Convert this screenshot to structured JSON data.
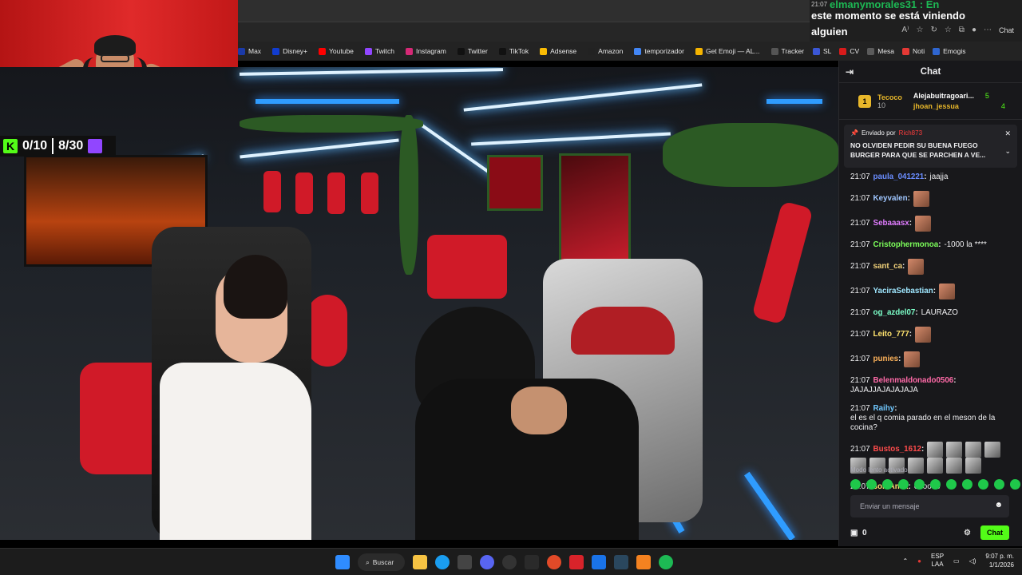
{
  "notification": {
    "time": "21:07",
    "sender": "elmanymorales31 : En",
    "text_line1": "este momento se está viniendo",
    "text_line2": "alguien",
    "chat_label": "Chat"
  },
  "bookmarks": [
    {
      "label": "Max",
      "color": "#1b3aa8"
    },
    {
      "label": "Disney+",
      "color": "#113ccf"
    },
    {
      "label": "Youtube",
      "color": "#ff0000"
    },
    {
      "label": "Twitch",
      "color": "#9146ff"
    },
    {
      "label": "Instagram",
      "color": "#d62976"
    },
    {
      "label": "Twitter",
      "color": "#111111"
    },
    {
      "label": "TikTok",
      "color": "#111111"
    },
    {
      "label": "Adsense",
      "color": "#fbbc04"
    },
    {
      "label": "Amazon",
      "color": "#222222"
    },
    {
      "label": "temporizador",
      "color": "#4285f4"
    },
    {
      "label": "Get Emoji — AL...",
      "color": "#f5b400"
    },
    {
      "label": "Tracker",
      "color": "#555555"
    }
  ],
  "bookmarks_right": [
    {
      "label": "SL",
      "color": "#3b57d6"
    },
    {
      "label": "CV",
      "color": "#d81b1b"
    },
    {
      "label": "Mesa",
      "color": "#5b5b5b"
    },
    {
      "label": "Noti",
      "color": "#e53935"
    },
    {
      "label": "Emogis",
      "color": "#2f66d0"
    }
  ],
  "scoreboard": {
    "left": "0/10",
    "right": "8/30"
  },
  "chat": {
    "title": "Chat",
    "leaders": [
      {
        "rank": "1",
        "name": "Tecoco",
        "points": "10"
      },
      {
        "name": "Alejabuitragoari...",
        "points": "5"
      },
      {
        "name": "jhoan_jessua",
        "points": "4"
      }
    ],
    "pinned": {
      "by_label": "Enviado por",
      "by_name": "Rich873",
      "message": "NO OLVIDEN PEDIR SU BUENA FUEGO BURGER PARA QUE SE PARCHEN A VE..."
    },
    "messages": [
      {
        "time": "21:07",
        "user": "paula_041221",
        "color": "#6a8dff",
        "text": "jaajja",
        "emotes": 0
      },
      {
        "time": "21:07",
        "user": "Keyvalen",
        "color": "#9fc6ff",
        "text": "",
        "emotes": 1
      },
      {
        "time": "21:07",
        "user": "Sebaaasx",
        "color": "#e07cff",
        "text": "",
        "emotes": 1
      },
      {
        "time": "21:07",
        "user": "Cristophermonoa",
        "color": "#7cff5a",
        "text": "-1000 la ****",
        "emotes": 0
      },
      {
        "time": "21:07",
        "user": "sant_ca",
        "color": "#f2d27a",
        "text": "",
        "emotes": 1
      },
      {
        "time": "21:07",
        "user": "YaciraSebastian",
        "color": "#9fe7ff",
        "text": "",
        "emotes": 1
      },
      {
        "time": "21:07",
        "user": "og_azdel07",
        "color": "#7cffc9",
        "text": "LAURAZO",
        "emotes": 0
      },
      {
        "time": "21:07",
        "user": "Leito_777",
        "color": "#ffe36e",
        "text": "",
        "emotes": 1
      },
      {
        "time": "21:07",
        "user": "punies",
        "color": "#ffb35a",
        "text": "",
        "emotes": 1
      },
      {
        "time": "21:07",
        "user": "Belenmaldonado0506",
        "color": "#ff6aa8",
        "text": "JAJAJJAJAJAJAJA",
        "emotes": 0
      },
      {
        "time": "21:07",
        "user": "Raihy",
        "color": "#70c8ff",
        "text": "el es el q comia parado en el meson de la cocina?",
        "emotes": 0
      },
      {
        "time": "21:07",
        "user": "Bustos_1612",
        "color": "#ff4b4b",
        "text": "",
        "emotes": 11
      },
      {
        "time": "21:07",
        "user": "soloAnax",
        "color": "#ffe36e",
        "text": "oooooo",
        "emotes": 0
      }
    ],
    "slow_mode": "Modo lento activado",
    "input_placeholder": "Enviar un mensaje",
    "balance": "0",
    "send_label": "Chat"
  },
  "taskbar": {
    "search_label": "Buscar",
    "lang_line1": "ESP",
    "lang_line2": "LAA",
    "time": "9:07 p. m.",
    "date": "1/1/2026"
  }
}
